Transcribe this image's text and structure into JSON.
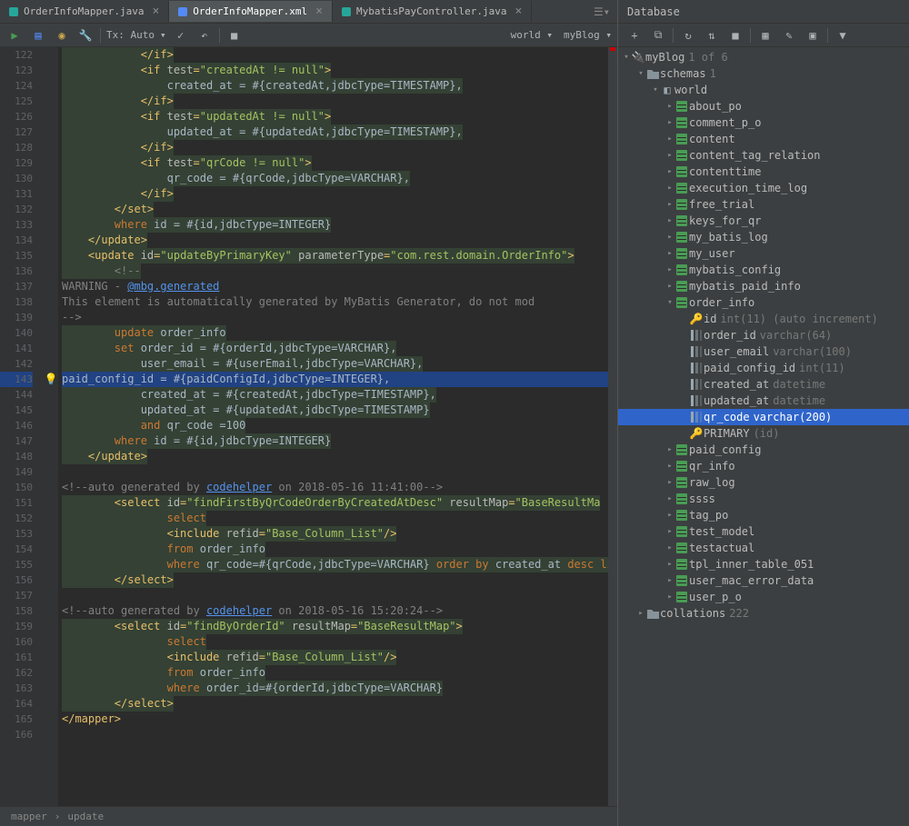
{
  "tabs": [
    {
      "label": "OrderInfoMapper.java",
      "active": false,
      "iconColor": "#26a69a"
    },
    {
      "label": "OrderInfoMapper.xml",
      "active": true,
      "iconColor": "#548af7"
    },
    {
      "label": "MybatisPayController.java",
      "active": false,
      "iconColor": "#26a69a"
    }
  ],
  "toolbar": {
    "txLabel": "Tx: Auto",
    "dropdown1": "world",
    "dropdown2": "myBlog"
  },
  "gutter": {
    "start": 122,
    "end": 166
  },
  "code": [
    {
      "n": 122,
      "bg": true,
      "i": 6,
      "html": "<span class='tag'>&lt;/if&gt;</span>"
    },
    {
      "n": 123,
      "bg": true,
      "i": 6,
      "html": "<span class='tag'>&lt;if </span><span class='attr'>test</span><span class='tag'>=</span><span class='str'>\"createdAt != null\"</span><span class='tag'>&gt;</span>"
    },
    {
      "n": 124,
      "bg": true,
      "i": 8,
      "html": "<span class='txt'>created_at = #{</span><span class='txt'>createdAt</span><span class='txt'>,jdbcType=</span><span class='txt'>TIMESTAMP</span><span class='txt'>},</span>"
    },
    {
      "n": 125,
      "bg": true,
      "i": 6,
      "html": "<span class='tag'>&lt;/if&gt;</span>"
    },
    {
      "n": 126,
      "bg": true,
      "i": 6,
      "html": "<span class='tag'>&lt;if </span><span class='attr'>test</span><span class='tag'>=</span><span class='str'>\"updatedAt != null\"</span><span class='tag'>&gt;</span>"
    },
    {
      "n": 127,
      "bg": true,
      "i": 8,
      "html": "<span class='txt'>updated_at = #{</span><span class='txt'>updatedAt</span><span class='txt'>,jdbcType=</span><span class='txt'>TIMESTAMP</span><span class='txt'>},</span>"
    },
    {
      "n": 128,
      "bg": true,
      "i": 6,
      "html": "<span class='tag'>&lt;/if&gt;</span>"
    },
    {
      "n": 129,
      "bg": true,
      "i": 6,
      "html": "<span class='tag'>&lt;if </span><span class='attr'>test</span><span class='tag'>=</span><span class='str'>\"qrCode != null\"</span><span class='tag'>&gt;</span>"
    },
    {
      "n": 130,
      "bg": true,
      "i": 8,
      "html": "<span class='txt'>qr_code = #{</span><span class='txt'>qrCode</span><span class='txt'>,jdbcType=</span><span class='txt'>VARCHAR</span><span class='txt'>},</span>"
    },
    {
      "n": 131,
      "bg": true,
      "i": 6,
      "html": "<span class='tag'>&lt;/if&gt;</span>"
    },
    {
      "n": 132,
      "bg": true,
      "i": 4,
      "html": "<span class='tag'>&lt;/set&gt;</span>"
    },
    {
      "n": 133,
      "bg": true,
      "i": 4,
      "html": "<span class='kw'>where</span><span class='txt'> id = #{id,jdbcType=</span><span class='txt'>INTEGER</span><span class='txt'>}</span>"
    },
    {
      "n": 134,
      "bg": true,
      "i": 2,
      "html": "<span class='tag'>&lt;/update&gt;</span>"
    },
    {
      "n": 135,
      "bg": true,
      "i": 2,
      "html": "<span class='tag'>&lt;update </span><span class='attr'>id</span><span class='tag'>=</span><span class='str'>\"updateByPrimaryKey\"</span><span class='tag'> </span><span class='attr'>parameterType</span><span class='tag'>=</span><span class='str'>\"com.rest.domain.OrderInfo\"</span><span class='tag'>&gt;</span>"
    },
    {
      "n": 136,
      "bg": true,
      "i": 4,
      "html": "<span class='cmt'>&lt;!--</span>"
    },
    {
      "n": 137,
      "bg": false,
      "i": 6,
      "html": "<span class='cmt'>WARNING - </span><span class='link'>@mbg.generated</span>"
    },
    {
      "n": 138,
      "bg": false,
      "i": 6,
      "html": "<span class='cmt'>This element is automatically generated by MyBatis Generator, do not mod</span>"
    },
    {
      "n": 139,
      "bg": false,
      "i": 4,
      "html": "<span class='cmt'>--&gt;</span>"
    },
    {
      "n": 140,
      "bg": true,
      "i": 4,
      "html": "<span class='kw'>update</span><span class='txt'> order_info</span>"
    },
    {
      "n": 141,
      "bg": true,
      "i": 4,
      "html": "<span class='kw'>set</span><span class='txt'> order_id = #{orderId,jdbcType=</span><span class='txt'>VARCHAR</span><span class='txt'>},</span>"
    },
    {
      "n": 142,
      "bg": true,
      "i": 6,
      "html": "<span class='txt'>user_email = #{userEmail,jdbcType=</span><span class='txt'>VARCHAR</span><span class='txt'>},</span>"
    },
    {
      "n": 143,
      "bg": false,
      "hl": true,
      "bulb": true,
      "i": 6,
      "html": "<span class='txt'>paid_config_id = #{paidConfigId,jdbcType=</span><span class='txt'>INTEGER</span><span class='txt'>},</span>"
    },
    {
      "n": 144,
      "bg": true,
      "i": 6,
      "html": "<span class='txt'>created_at = #{createdAt,jdbcType=</span><span class='txt'>TIMESTAMP</span><span class='txt'>},</span>"
    },
    {
      "n": 145,
      "bg": true,
      "i": 6,
      "html": "<span class='txt'>updated_at = #{updatedAt,jdbcType=</span><span class='txt'>TIMESTAMP</span><span class='txt'>}</span>"
    },
    {
      "n": 146,
      "bg": true,
      "i": 6,
      "html": "<span class='kw'>and</span><span class='txt'> qr_code =100</span>"
    },
    {
      "n": 147,
      "bg": true,
      "i": 4,
      "html": "<span class='kw'>where</span><span class='txt'> id = #{id,jdbcType=</span><span class='txt'>INTEGER</span><span class='txt'>}</span>"
    },
    {
      "n": 148,
      "bg": true,
      "i": 2,
      "html": "<span class='tag'>&lt;/update&gt;</span>"
    },
    {
      "n": 149,
      "bg": false,
      "i": 0,
      "html": ""
    },
    {
      "n": 150,
      "bg": false,
      "i": 2,
      "html": "<span class='cmt'>&lt;!--auto generated by </span><span class='link'>codehelper</span><span class='cmt'> on 2018-05-16 11:41:00--&gt;</span>"
    },
    {
      "n": 151,
      "bg": true,
      "i": 4,
      "html": "<span class='tag'>&lt;select </span><span class='attr'>id</span><span class='tag'>=</span><span class='str'>\"findFirstByQrCodeOrderByCreatedAtDesc\"</span><span class='tag'> </span><span class='attr'>resultMap</span><span class='tag'>=</span><span class='str'>\"BaseResultMa</span>"
    },
    {
      "n": 152,
      "bg": true,
      "i": 8,
      "html": "<span class='kw'>select</span>"
    },
    {
      "n": 153,
      "bg": true,
      "i": 8,
      "html": "<span class='tag'>&lt;include </span><span class='attr'>refid</span><span class='tag'>=</span><span class='str'>\"Base_Column_List\"</span><span class='tag'>/&gt;</span>"
    },
    {
      "n": 154,
      "bg": true,
      "i": 8,
      "html": "<span class='kw'>from</span><span class='txt'> order_info</span>"
    },
    {
      "n": 155,
      "bg": true,
      "i": 8,
      "html": "<span class='kw'>where</span><span class='txt'> qr_code=#{qrCode,jdbcType=VARCHAR} </span><span class='kw'>order by</span><span class='txt'> created_at </span><span class='kw'>desc limi</span>"
    },
    {
      "n": 156,
      "bg": true,
      "i": 4,
      "html": "<span class='tag'>&lt;/select&gt;</span>"
    },
    {
      "n": 157,
      "bg": false,
      "i": 0,
      "html": ""
    },
    {
      "n": 158,
      "bg": false,
      "i": 2,
      "html": "<span class='cmt'>&lt;!--auto generated by </span><span class='link'>codehelper</span><span class='cmt'> on 2018-05-16 15:20:24--&gt;</span>"
    },
    {
      "n": 159,
      "bg": true,
      "i": 4,
      "html": "<span class='tag'>&lt;select </span><span class='attr'>id</span><span class='tag'>=</span><span class='str'>\"findByOrderId\"</span><span class='tag'> </span><span class='attr'>resultMap</span><span class='tag'>=</span><span class='str'>\"BaseResultMap\"</span><span class='tag'>&gt;</span>"
    },
    {
      "n": 160,
      "bg": true,
      "i": 8,
      "html": "<span class='kw'>select</span>"
    },
    {
      "n": 161,
      "bg": true,
      "i": 8,
      "html": "<span class='tag'>&lt;include </span><span class='attr'>refid</span><span class='tag'>=</span><span class='str'>\"Base_Column_List\"</span><span class='tag'>/&gt;</span>"
    },
    {
      "n": 162,
      "bg": true,
      "i": 8,
      "html": "<span class='kw'>from</span><span class='txt'> order_info</span>"
    },
    {
      "n": 163,
      "bg": true,
      "i": 8,
      "html": "<span class='kw'>where</span><span class='txt'> order_id=#{orderId,jdbcType=VARCHAR}</span>"
    },
    {
      "n": 164,
      "bg": true,
      "i": 4,
      "html": "<span class='tag'>&lt;/select&gt;</span>"
    },
    {
      "n": 165,
      "bg": false,
      "i": 0,
      "html": "<span class='tag'>&lt;/mapper&gt;</span>"
    },
    {
      "n": 166,
      "bg": false,
      "i": 0,
      "html": ""
    }
  ],
  "breadcrumb": [
    "mapper",
    "update"
  ],
  "db": {
    "title": "Database",
    "root": {
      "label": "myBlog",
      "count": "1 of 6"
    },
    "schemas": {
      "label": "schemas",
      "count": "1"
    },
    "world": "world",
    "tables": [
      "about_po",
      "comment_p_o",
      "content",
      "content_tag_relation",
      "contenttime",
      "execution_time_log",
      "free_trial",
      "keys_for_qr",
      "my_batis_log",
      "my_user",
      "mybatis_config",
      "mybatis_paid_info"
    ],
    "orderInfo": {
      "name": "order_info",
      "cols": [
        {
          "name": "id",
          "type": "int(11) (auto increment)",
          "key": true
        },
        {
          "name": "order_id",
          "type": "varchar(64)"
        },
        {
          "name": "user_email",
          "type": "varchar(100)"
        },
        {
          "name": "paid_config_id",
          "type": "int(11)"
        },
        {
          "name": "created_at",
          "type": "datetime"
        },
        {
          "name": "updated_at",
          "type": "datetime"
        },
        {
          "name": "qr_code",
          "type": "varchar(200)",
          "selected": true
        }
      ],
      "primary": {
        "label": "PRIMARY",
        "detail": "(id)"
      }
    },
    "tablesAfter": [
      "paid_config",
      "qr_info",
      "raw_log",
      "ssss",
      "tag_po",
      "test_model",
      "testactual",
      "tpl_inner_table_051",
      "user_mac_error_data",
      "user_p_o"
    ],
    "collations": {
      "label": "collations",
      "count": "222"
    }
  }
}
